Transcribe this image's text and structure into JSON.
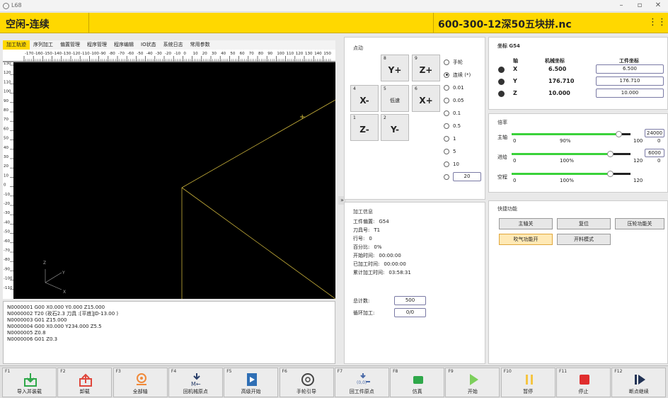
{
  "window": {
    "title": "L68"
  },
  "header": {
    "status": "空闲-连续",
    "filename": "600-300-12深50五块拼.nc",
    "menu_icon": "grid-icon"
  },
  "tabs": [
    "加工轨迹",
    "序列加工",
    "偏置管理",
    "程序管理",
    "程序编辑",
    "IO状态",
    "系统日志",
    "常用参数"
  ],
  "active_tab": 0,
  "ruler": {
    "x_labels": [
      "-170",
      "-160",
      "-150",
      "-140",
      "-130",
      "-120",
      "-110",
      "-100",
      "-90",
      "-80",
      "-70",
      "-60",
      "-50",
      "-40",
      "-30",
      "-20",
      "-10",
      "0",
      "10",
      "20",
      "30",
      "40",
      "50",
      "60",
      "70",
      "80",
      "90",
      "100",
      "110",
      "120",
      "130",
      "140",
      "150"
    ],
    "y_labels": [
      "130",
      "120",
      "110",
      "100",
      "90",
      "80",
      "70",
      "60",
      "50",
      "40",
      "30",
      "20",
      "10",
      "0",
      "-10",
      "-20",
      "-30",
      "-40",
      "-50",
      "-60",
      "-70",
      "-80",
      "-90",
      "-100",
      "-110"
    ]
  },
  "canvas": {
    "axis_z": "Z",
    "axis_y": "Y",
    "axis_x": "X"
  },
  "gcode": [
    "N0000001   G00 X0.000 Y0.000 Z15.000",
    "N0000002   T20 (玫石2.3 刀具 :[平底]JD-13.00 )",
    "N0000003   G01 Z15.000",
    "N0000004   G00 X0.000 Y234.000 Z5.5",
    "N0000005   Z0.8",
    "N0000006   G01 Z0.3"
  ],
  "collapse_label": "»",
  "jog": {
    "title": "点动",
    "buttons": [
      {
        "num": "8",
        "label": "Y+"
      },
      {
        "num": "9",
        "label": "Z+"
      },
      {
        "num": "4",
        "label": "X-"
      },
      {
        "num": "5",
        "label": "低速"
      },
      {
        "num": "6",
        "label": "X+"
      },
      {
        "num": "1",
        "label": "Z-"
      },
      {
        "num": "2",
        "label": "Y-"
      }
    ],
    "modes": [
      "手轮",
      "连续 (*)",
      "0.01",
      "0.05",
      "0.1",
      "0.5",
      "1",
      "5",
      "10"
    ],
    "selected_mode": 1,
    "custom_step": "20"
  },
  "coords": {
    "title": "坐标 G54",
    "headers": {
      "axis": "轴",
      "machine": "机械坐标",
      "work": "工件坐标"
    },
    "rows": [
      {
        "axis": "X",
        "machine": "6.500",
        "work": "6.500"
      },
      {
        "axis": "Y",
        "machine": "176.710",
        "work": "176.710"
      },
      {
        "axis": "Z",
        "machine": "10.000",
        "work": "10.000"
      }
    ]
  },
  "rates": {
    "title": "倍率",
    "spindle": {
      "label": "主轴",
      "min": "0",
      "percent": "90%",
      "current": "100",
      "value": 0.9,
      "set": "24000",
      "set2": "0"
    },
    "feed": {
      "label": "进给",
      "min": "0",
      "percent": "100%",
      "current": "120",
      "value": 0.83,
      "set": "6000",
      "set2": "0"
    },
    "rapid": {
      "label": "空程",
      "min": "0",
      "percent": "100%",
      "current": "120",
      "value": 0.83
    }
  },
  "info": {
    "title": "加工信息",
    "rows": [
      {
        "label": "工件偏置:",
        "value": "G54"
      },
      {
        "label": "刀具号:",
        "value": "T1"
      },
      {
        "label": "行号:",
        "value": "0"
      },
      {
        "label": "百分比:",
        "value": "0%"
      },
      {
        "label": "开始时间:",
        "value": "00:00:00"
      },
      {
        "label": "已加工时间:",
        "value": "00:00:00"
      },
      {
        "label": "累计加工时间:",
        "value": "03:58:31"
      }
    ],
    "total_label": "总计数:",
    "total_value": "500",
    "cycle_label": "循环加工:",
    "cycle_value": "0/0"
  },
  "quick": {
    "title": "快捷功能",
    "buttons": [
      "主轴关",
      "复位",
      "压轮功能关",
      "吹气功能开",
      "开料模式"
    ]
  },
  "fkeys": [
    {
      "fn": "F1",
      "label": "导入并装载",
      "icon": "import-icon",
      "color": "#2fa84a"
    },
    {
      "fn": "F2",
      "label": "卸载",
      "icon": "unload-icon",
      "color": "#e0473c"
    },
    {
      "fn": "F3",
      "label": "全部轴",
      "icon": "home-all-axes-icon",
      "color": "#f08a3a"
    },
    {
      "fn": "F4",
      "label": "回机械原点",
      "icon": "machine-home-icon",
      "color": "#2a3f6a"
    },
    {
      "fn": "F5",
      "label": "高级开始",
      "icon": "advanced-start-icon",
      "color": "#2f6fb5"
    },
    {
      "fn": "F6",
      "label": "手轮引导",
      "icon": "handwheel-icon",
      "color": "#444444"
    },
    {
      "fn": "F7",
      "label": "回工件原点",
      "icon": "work-home-icon",
      "color": "#4a6aa8",
      "sub": "(0,0)"
    },
    {
      "fn": "F8",
      "label": "仿真",
      "icon": "simulate-icon",
      "color": "#2fa84a"
    },
    {
      "fn": "F9",
      "label": "开始",
      "icon": "play-icon",
      "color": "#7ccf5b"
    },
    {
      "fn": "F10",
      "label": "暂停",
      "icon": "pause-icon",
      "color": "#f5c542"
    },
    {
      "fn": "F11",
      "label": "停止",
      "icon": "stop-icon",
      "color": "#e02d2d"
    },
    {
      "fn": "F12",
      "label": "断点继续",
      "icon": "resume-icon",
      "color": "#223355"
    }
  ]
}
